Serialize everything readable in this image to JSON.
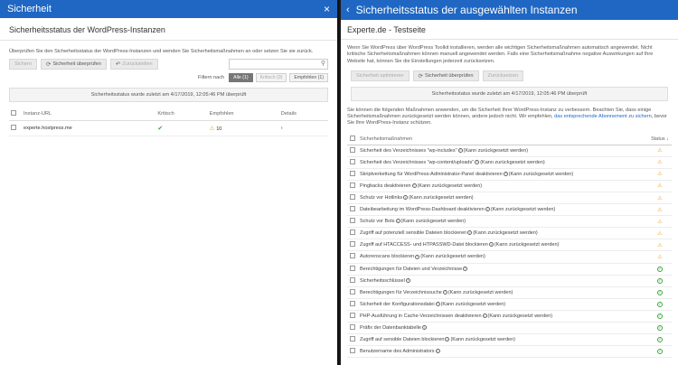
{
  "left": {
    "title": "Sicherheit",
    "close_glyph": "×",
    "subtitle": "Sicherheitsstatus der WordPress-Instanzen",
    "description": "Überprüfen Sie den Sicherheitsstatus der WordPress-Instanzen und wenden Sie Sicherheitsmaßnahmen an oder setzen Sie sie zurück.",
    "buttons": {
      "secure": "Sichern",
      "check": "Sicherheit überprüfen",
      "revert": "Zurückstellen"
    },
    "filter": {
      "label": "Filtern nach",
      "all": "Alle (1)",
      "critical": "Kritisch (0)",
      "recommended": "Empfohlen (1)"
    },
    "status_text": "Sicherheitsstatus wurde zuletzt am 4/17/2019, 12:05:46 PM überprüft",
    "columns": {
      "instance": "Instanz-URL",
      "critical": "Kritisch",
      "recommended": "Empfohlen",
      "details": "Details"
    },
    "rows": [
      {
        "url": "experte.hostpress.me",
        "recommended_count": "10",
        "details_glyph": "›"
      }
    ]
  },
  "right": {
    "back_glyph": "‹",
    "title": "Sicherheitsstatus der ausgewählten Instanzen",
    "subtitle": "Experte.de - Testseite",
    "description": "Wenn Sie WordPress über WordPress Toolkit installieren, werden alle wichtigen Sicherheitsmaßnahmen automatisch angewendet. Nicht kritische Sicherheitsmaßnahmen können manuell angewendet werden. Falls eine Sicherheitsmaßnahme negative Auswirkungen auf Ihre Website hat, können Sie die Einstellungen jederzeit zurücksetzen.",
    "buttons": {
      "secure": "Sicherheit optimieren",
      "check": "Sicherheit überprüfen",
      "revert": "Zurücksetzen"
    },
    "status_text": "Sicherheitsstatus wurde zuletzt am 4/17/2019, 12:05:46 PM überprüft",
    "note": "Sie können die folgenden Maßnahmen anwenden, um die Sicherheit Ihrer WordPress-Instanz zu verbessern. Beachten Sie, dass einige Sicherheitsmaßnahmen zurückgesetzt werden können, andere jedoch nicht. Wir empfehlen, ",
    "note_link": "das entsprechende Abonnement zu sichern",
    "note_end": ", bevor Sie Ihre WordPress-Instanz schützen.",
    "col_measure": "Sicherheitsmaßnahmen",
    "col_status": "Status ↓",
    "resettable_text": "(Kann zurückgesetzt werden)",
    "measures": [
      {
        "name": "Sicherheit des Verzeichnisses \"wp-includes\"",
        "resettable": true,
        "status": "warn"
      },
      {
        "name": "Sicherheit des Verzeichnisses \"wp-content/uploads\"",
        "resettable": true,
        "status": "warn"
      },
      {
        "name": "Skriptverkettung für WordPress-Administrator-Panel deaktivieren",
        "resettable": true,
        "status": "warn"
      },
      {
        "name": "Pingbacks deaktivieren",
        "resettable": true,
        "status": "warn"
      },
      {
        "name": "Schutz vor Hotlinks",
        "resettable": true,
        "status": "warn"
      },
      {
        "name": "Dateibearbeitung im WordPress-Dashboard deaktivieren",
        "resettable": true,
        "status": "warn"
      },
      {
        "name": "Schutz vor Bots",
        "resettable": true,
        "status": "warn"
      },
      {
        "name": "Zugriff auf potenziell sensible Dateien blockieren",
        "resettable": true,
        "status": "warn"
      },
      {
        "name": "Zugriff auf HTACCESS- und HTPASSWD-Datei blockieren",
        "resettable": true,
        "status": "warn"
      },
      {
        "name": "Autorenscans blockieren",
        "resettable": true,
        "status": "warn"
      },
      {
        "name": "Berechtigungen für Dateien und Verzeichnisse",
        "resettable": false,
        "status": "ok"
      },
      {
        "name": "Sicherheitsschlüssel",
        "resettable": false,
        "status": "ok"
      },
      {
        "name": "Berechtigungen für Verzeichnissuche",
        "resettable": true,
        "status": "ok"
      },
      {
        "name": "Sicherheit der Konfigurationsdatei",
        "resettable": true,
        "status": "ok"
      },
      {
        "name": "PHP-Ausführung in Cache-Verzeichnissen deaktivieren",
        "resettable": true,
        "status": "ok"
      },
      {
        "name": "Präfix der Datenbanktabelle",
        "resettable": false,
        "status": "ok"
      },
      {
        "name": "Zugriff auf sensible Dateien blockieren",
        "resettable": true,
        "status": "ok"
      },
      {
        "name": "Benutzername des Administrators",
        "resettable": false,
        "status": "ok"
      }
    ]
  },
  "colors": {
    "header_blue": "#1f67c3",
    "ok_green": "#3aa83a",
    "warn_orange": "#f0a020"
  }
}
